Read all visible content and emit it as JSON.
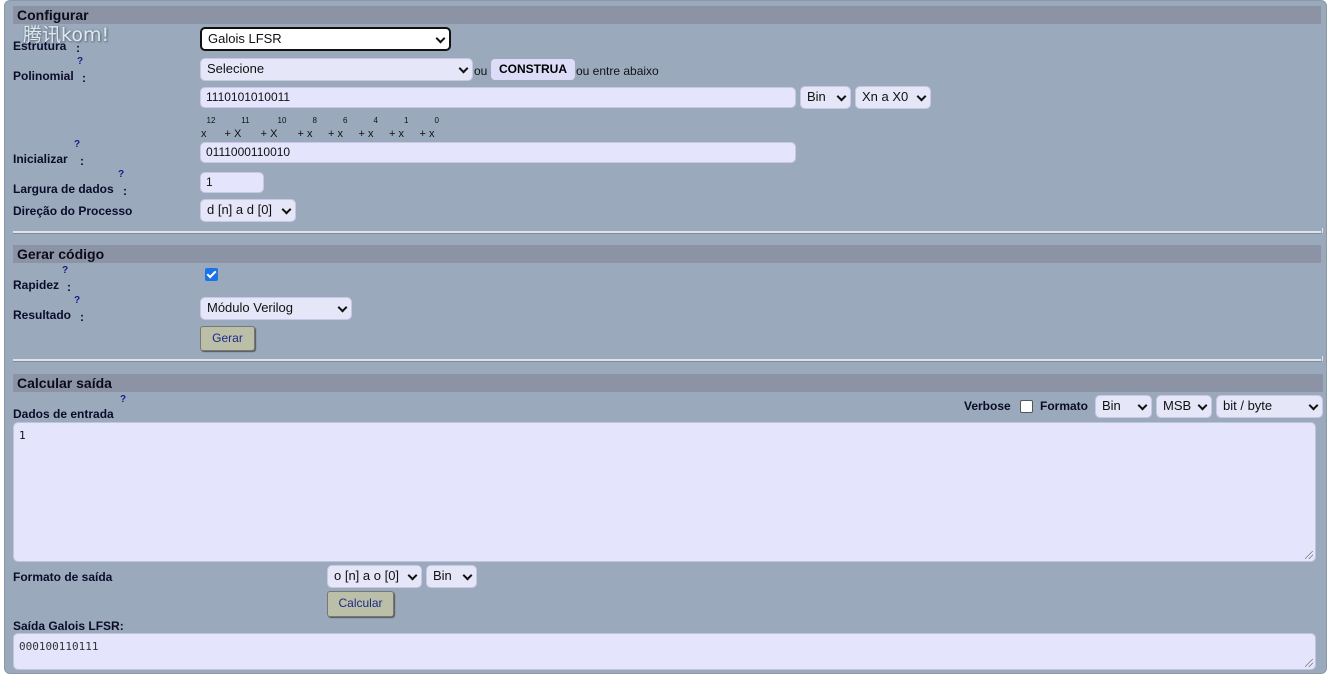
{
  "watermark": "腾讯kom!",
  "sections": {
    "configurar": "Configurar",
    "gerar": "Gerar código",
    "calcular": "Calcular saída"
  },
  "help_mark": "?",
  "colon": ":",
  "config": {
    "estrutura_label": "Estrutura",
    "estrutura_value": "Galois LFSR",
    "polinomial_label": "Polinomial",
    "polinomial_select": "Selecione",
    "ou_text": "ou",
    "construa_label": "CONSTRUA",
    "ou_entre_text": "ou entre abaixo",
    "poly_value": "1110101010011",
    "poly_format": "Bin",
    "poly_order": "Xn a X0",
    "poly_terms": [
      {
        "base": "x",
        "exp": "12"
      },
      {
        "base": "+ X",
        "exp": "11"
      },
      {
        "base": "+ X",
        "exp": "10"
      },
      {
        "base": "+ x",
        "exp": "8"
      },
      {
        "base": "+ x",
        "exp": "6"
      },
      {
        "base": "+ x",
        "exp": "4"
      },
      {
        "base": "+ x",
        "exp": "1"
      },
      {
        "base": "+ x",
        "exp": "0"
      }
    ],
    "inicializar_label": "Inicializar",
    "inicializar_value": "0111000110010",
    "largura_label": "Largura de dados",
    "largura_value": "1",
    "direcao_label": "Direção do Processo",
    "direcao_value": "d [n] a d [0]"
  },
  "gerar": {
    "rapidez_label": "Rapidez",
    "rapidez_checked": true,
    "resultado_label": "Resultado",
    "resultado_value": "Módulo Verilog",
    "gerar_button": "Gerar"
  },
  "calcular": {
    "dados_label": "Dados de entrada",
    "verbose_label": "Verbose",
    "verbose_checked": false,
    "formato_label": "Formato",
    "formato_value": "Bin",
    "msb_value": "MSB",
    "bitbyte_value": "bit / byte",
    "input_data": "1",
    "formato_saida_label": "Formato de saída",
    "saida_order": "o [n] a o [0]",
    "saida_format": "Bin",
    "calcular_button": "Calcular",
    "saida_label": "Saída Galois LFSR:",
    "saida_value": "000100110111"
  },
  "colors": {
    "panel": "#9aaabc",
    "header": "#8c93a5",
    "field": "#e4e4fc",
    "checkbox": "#1a73e8"
  }
}
